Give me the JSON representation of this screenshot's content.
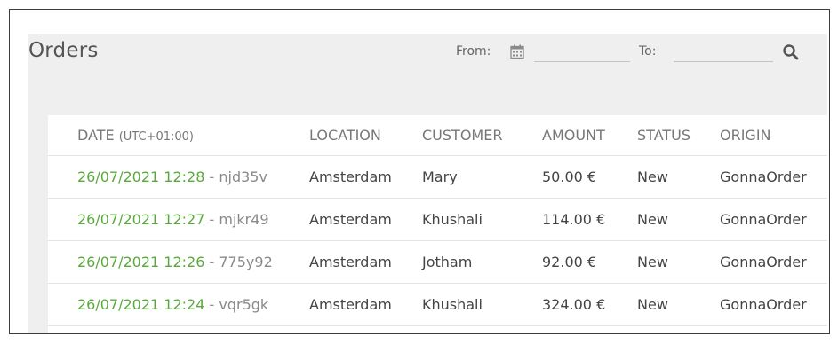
{
  "header": {
    "title": "Orders",
    "from_label": "From:",
    "to_label": "To:",
    "from_value": "",
    "to_value": ""
  },
  "icons": {
    "calendar": "calendar-icon",
    "search": "search-icon"
  },
  "colors": {
    "date_link": "#5aa83e",
    "order_id": "#8a8a8a",
    "panel_bg": "#efefef"
  },
  "table": {
    "columns": {
      "date": "DATE",
      "date_tz": "(UTC+01:00)",
      "location": "LOCATION",
      "customer": "CUSTOMER",
      "amount": "AMOUNT",
      "status": "STATUS",
      "origin": "ORIGIN"
    },
    "rows": [
      {
        "date": "26/07/2021 12:28",
        "id": "njd35v",
        "location": "Amsterdam",
        "customer": "Mary",
        "amount": "50.00 €",
        "status": "New",
        "origin": "GonnaOrder"
      },
      {
        "date": "26/07/2021 12:27",
        "id": "mjkr49",
        "location": "Amsterdam",
        "customer": "Khushali",
        "amount": "114.00 €",
        "status": "New",
        "origin": "GonnaOrder"
      },
      {
        "date": "26/07/2021 12:26",
        "id": "775y92",
        "location": "Amsterdam",
        "customer": "Jotham",
        "amount": "92.00 €",
        "status": "New",
        "origin": "GonnaOrder"
      },
      {
        "date": "26/07/2021 12:24",
        "id": "vqr5gk",
        "location": "Amsterdam",
        "customer": "Khushali",
        "amount": "324.00 €",
        "status": "New",
        "origin": "GonnaOrder"
      }
    ]
  }
}
